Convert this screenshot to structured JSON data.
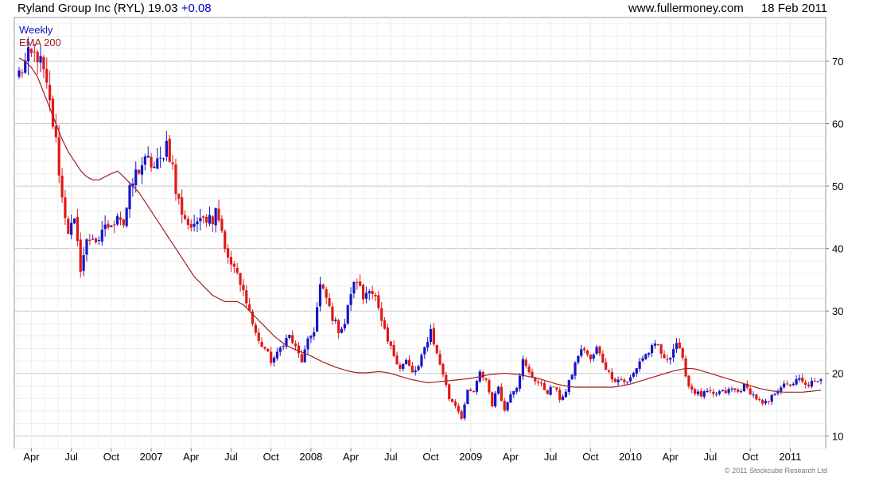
{
  "header": {
    "title": "Ryland Group Inc (RYL)",
    "price": "19.03",
    "change": "+0.08",
    "source": "www.fullermoney.com",
    "date": "18 Feb 2011"
  },
  "footer": {
    "copyright": "© 2011 Stockcube Research Ltd"
  },
  "chart_data": {
    "type": "candlestick",
    "title": "Ryland Group Inc (RYL) 19.03 +0.08",
    "legend": [
      "Weekly",
      "EMA 200"
    ],
    "legend_position": "top-left",
    "grid": true,
    "colors": {
      "up": "#1515c8",
      "down": "#e01818",
      "ema": "#a02020",
      "grid": "#d4d4d4"
    },
    "ylim": [
      8,
      77
    ],
    "yticks": [
      10,
      20,
      30,
      40,
      50,
      60,
      70
    ],
    "x_tick_labels": [
      "Apr",
      "Jul",
      "Oct",
      "2007",
      "Apr",
      "Jul",
      "Oct",
      "2008",
      "Apr",
      "Jul",
      "Oct",
      "2009",
      "Apr",
      "Jul",
      "Oct",
      "2010",
      "Apr",
      "Jul",
      "Oct",
      "2011"
    ],
    "x_tick_weeks": [
      4,
      17,
      30,
      43,
      56,
      69,
      82,
      95,
      108,
      121,
      134,
      147,
      160,
      173,
      186,
      199,
      212,
      225,
      238,
      251
    ],
    "weeks": 262,
    "close_anchors": [
      [
        0,
        68
      ],
      [
        3,
        70.5
      ],
      [
        6,
        71
      ],
      [
        8,
        68
      ],
      [
        10,
        63
      ],
      [
        12,
        57
      ],
      [
        14,
        48
      ],
      [
        16,
        43
      ],
      [
        18,
        44
      ],
      [
        20,
        37
      ],
      [
        22,
        41
      ],
      [
        24,
        42
      ],
      [
        26,
        40.5
      ],
      [
        28,
        44
      ],
      [
        30,
        43
      ],
      [
        32,
        46
      ],
      [
        34,
        44
      ],
      [
        36,
        49
      ],
      [
        38,
        52
      ],
      [
        40,
        53.5
      ],
      [
        42,
        54
      ],
      [
        44,
        53
      ],
      [
        46,
        54
      ],
      [
        48,
        57
      ],
      [
        50,
        53
      ],
      [
        51,
        49
      ],
      [
        53,
        46
      ],
      [
        55,
        44
      ],
      [
        57,
        43
      ],
      [
        59,
        46
      ],
      [
        61,
        45
      ],
      [
        63,
        45
      ],
      [
        64,
        47
      ],
      [
        66,
        43
      ],
      [
        68,
        38
      ],
      [
        70,
        37
      ],
      [
        72,
        34
      ],
      [
        74,
        32
      ],
      [
        76,
        28
      ],
      [
        78,
        25
      ],
      [
        80,
        24
      ],
      [
        82,
        22
      ],
      [
        84,
        23
      ],
      [
        86,
        25
      ],
      [
        88,
        26
      ],
      [
        90,
        24
      ],
      [
        92,
        22
      ],
      [
        94,
        25
      ],
      [
        96,
        27
      ],
      [
        98,
        34
      ],
      [
        100,
        32
      ],
      [
        102,
        29
      ],
      [
        104,
        27
      ],
      [
        106,
        28
      ],
      [
        108,
        33
      ],
      [
        110,
        35
      ],
      [
        112,
        32
      ],
      [
        114,
        34
      ],
      [
        116,
        32
      ],
      [
        118,
        28
      ],
      [
        120,
        25
      ],
      [
        122,
        23
      ],
      [
        124,
        21
      ],
      [
        126,
        22
      ],
      [
        128,
        20
      ],
      [
        130,
        21
      ],
      [
        132,
        24
      ],
      [
        134,
        27
      ],
      [
        136,
        23
      ],
      [
        138,
        20
      ],
      [
        140,
        16
      ],
      [
        142,
        15
      ],
      [
        144,
        13
      ],
      [
        146,
        17
      ],
      [
        148,
        17
      ],
      [
        150,
        20
      ],
      [
        152,
        19
      ],
      [
        154,
        15
      ],
      [
        156,
        18
      ],
      [
        158,
        14
      ],
      [
        160,
        17
      ],
      [
        162,
        18
      ],
      [
        164,
        22
      ],
      [
        166,
        20
      ],
      [
        168,
        19
      ],
      [
        170,
        18
      ],
      [
        172,
        17
      ],
      [
        174,
        18
      ],
      [
        176,
        16
      ],
      [
        178,
        17
      ],
      [
        180,
        20
      ],
      [
        182,
        23
      ],
      [
        184,
        24
      ],
      [
        186,
        22
      ],
      [
        188,
        24
      ],
      [
        190,
        22
      ],
      [
        192,
        20
      ],
      [
        194,
        19
      ],
      [
        196,
        19
      ],
      [
        198,
        18.5
      ],
      [
        200,
        20
      ],
      [
        202,
        22
      ],
      [
        204,
        23
      ],
      [
        206,
        24
      ],
      [
        208,
        24.5
      ],
      [
        210,
        22
      ],
      [
        212,
        23
      ],
      [
        214,
        25
      ],
      [
        216,
        22
      ],
      [
        218,
        18
      ],
      [
        220,
        17
      ],
      [
        222,
        16.5
      ],
      [
        224,
        17
      ],
      [
        226,
        16.5
      ],
      [
        228,
        17
      ],
      [
        230,
        17
      ],
      [
        232,
        17.5
      ],
      [
        234,
        17
      ],
      [
        236,
        18
      ],
      [
        238,
        17
      ],
      [
        240,
        16
      ],
      [
        242,
        15
      ],
      [
        244,
        15.5
      ],
      [
        246,
        17
      ],
      [
        248,
        18
      ],
      [
        250,
        18
      ],
      [
        252,
        18.5
      ],
      [
        254,
        19
      ],
      [
        256,
        18
      ],
      [
        258,
        18.5
      ],
      [
        260,
        18.5
      ],
      [
        261,
        19.03
      ]
    ],
    "ema_200": [
      [
        0,
        70.5
      ],
      [
        2,
        70
      ],
      [
        4,
        69
      ],
      [
        6,
        67.5
      ],
      [
        8,
        65
      ],
      [
        10,
        62.5
      ],
      [
        12,
        60
      ],
      [
        14,
        57.5
      ],
      [
        16,
        55.5
      ],
      [
        18,
        54
      ],
      [
        20,
        52.5
      ],
      [
        22,
        51.5
      ],
      [
        24,
        51
      ],
      [
        26,
        51
      ],
      [
        28,
        51.5
      ],
      [
        30,
        52
      ],
      [
        32,
        52.4
      ],
      [
        33,
        52
      ],
      [
        35,
        51
      ],
      [
        37,
        50
      ],
      [
        39,
        49
      ],
      [
        41,
        47.5
      ],
      [
        43,
        46
      ],
      [
        45,
        44.5
      ],
      [
        47,
        43
      ],
      [
        49,
        41.5
      ],
      [
        51,
        40
      ],
      [
        53,
        38.5
      ],
      [
        55,
        37
      ],
      [
        57,
        35.5
      ],
      [
        59,
        34.5
      ],
      [
        61,
        33.5
      ],
      [
        63,
        32.5
      ],
      [
        65,
        32
      ],
      [
        67,
        31.5
      ],
      [
        69,
        31.5
      ],
      [
        71,
        31.5
      ],
      [
        73,
        31
      ],
      [
        75,
        30
      ],
      [
        77,
        29
      ],
      [
        79,
        28
      ],
      [
        81,
        27
      ],
      [
        83,
        26
      ],
      [
        85,
        25.2
      ],
      [
        87,
        24.5
      ],
      [
        89,
        24
      ],
      [
        91,
        23.6
      ],
      [
        93,
        23.2
      ],
      [
        95,
        22.8
      ],
      [
        97,
        22.3
      ],
      [
        99,
        21.8
      ],
      [
        101,
        21.4
      ],
      [
        103,
        21
      ],
      [
        105,
        20.7
      ],
      [
        107,
        20.4
      ],
      [
        109,
        20.2
      ],
      [
        111,
        20.1
      ],
      [
        113,
        20.1
      ],
      [
        115,
        20.2
      ],
      [
        117,
        20.3
      ],
      [
        119,
        20.2
      ],
      [
        121,
        20
      ],
      [
        123,
        19.7
      ],
      [
        125,
        19.4
      ],
      [
        127,
        19.1
      ],
      [
        129,
        18.9
      ],
      [
        131,
        18.7
      ],
      [
        133,
        18.5
      ],
      [
        135,
        18.6
      ],
      [
        137,
        18.7
      ],
      [
        139,
        18.8
      ],
      [
        141,
        18.9
      ],
      [
        143,
        19
      ],
      [
        145,
        19.1
      ],
      [
        147,
        19.2
      ],
      [
        149,
        19.4
      ],
      [
        151,
        19.6
      ],
      [
        153,
        19.8
      ],
      [
        155,
        19.9
      ],
      [
        157,
        20
      ],
      [
        159,
        20
      ],
      [
        161,
        19.9
      ],
      [
        163,
        19.8
      ],
      [
        165,
        19.6
      ],
      [
        167,
        19.4
      ],
      [
        169,
        19.2
      ],
      [
        171,
        18.9
      ],
      [
        173,
        18.6
      ],
      [
        175,
        18.3
      ],
      [
        177,
        18.1
      ],
      [
        179,
        17.9
      ],
      [
        181,
        17.8
      ],
      [
        183,
        17.8
      ],
      [
        185,
        17.8
      ],
      [
        187,
        17.8
      ],
      [
        189,
        17.8
      ],
      [
        191,
        17.8
      ],
      [
        193,
        17.8
      ],
      [
        195,
        17.9
      ],
      [
        197,
        18.1
      ],
      [
        199,
        18.3
      ],
      [
        201,
        18.6
      ],
      [
        203,
        18.9
      ],
      [
        205,
        19.2
      ],
      [
        207,
        19.5
      ],
      [
        209,
        19.8
      ],
      [
        211,
        20.1
      ],
      [
        213,
        20.4
      ],
      [
        215,
        20.6
      ],
      [
        217,
        20.8
      ],
      [
        219,
        20.8
      ],
      [
        221,
        20.6
      ],
      [
        223,
        20.3
      ],
      [
        225,
        20
      ],
      [
        227,
        19.7
      ],
      [
        229,
        19.4
      ],
      [
        231,
        19.1
      ],
      [
        233,
        18.8
      ],
      [
        235,
        18.5
      ],
      [
        237,
        18.2
      ],
      [
        239,
        17.9
      ],
      [
        241,
        17.6
      ],
      [
        243,
        17.4
      ],
      [
        245,
        17.2
      ],
      [
        247,
        17.1
      ],
      [
        249,
        17
      ],
      [
        251,
        17
      ],
      [
        253,
        17
      ],
      [
        255,
        17
      ],
      [
        257,
        17.1
      ],
      [
        259,
        17.2
      ],
      [
        261,
        17.3
      ]
    ]
  }
}
